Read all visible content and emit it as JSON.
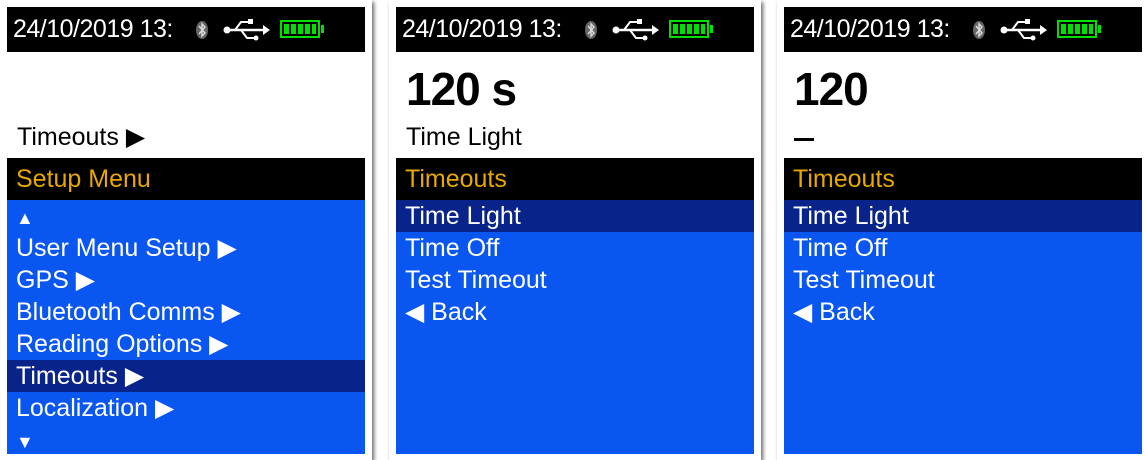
{
  "screens": [
    {
      "status": {
        "datetime": "24/10/2019  13:"
      },
      "display": {
        "value": "",
        "label": "Timeouts ▶"
      },
      "menu": {
        "title": "Setup Menu",
        "scroll_up": "▲",
        "items": [
          "User Menu Setup ▶",
          "GPS ▶",
          "Bluetooth Comms ▶",
          "Reading Options ▶",
          "Timeouts ▶",
          "Localization ▶"
        ],
        "selected_index": 4,
        "scroll_down": "▼"
      }
    },
    {
      "status": {
        "datetime": "24/10/2019  13:"
      },
      "display": {
        "value": "120 s",
        "label": "Time Light"
      },
      "menu": {
        "title": "Timeouts",
        "items": [
          "Time Light",
          "Time Off",
          "Test Timeout"
        ],
        "selected_index": 0,
        "back": "◀  Back"
      }
    },
    {
      "status": {
        "datetime": "24/10/2019  13:"
      },
      "display": {
        "value": "120",
        "label": ""
      },
      "menu": {
        "title": "Timeouts",
        "items": [
          "Time Light",
          "Time Off",
          "Test Timeout"
        ],
        "selected_index": 0,
        "back": "◀  Back"
      }
    }
  ],
  "colors": {
    "menu_bg": "#0a56f0",
    "selected_bg": "#08238a",
    "title_text": "#e8a700",
    "battery": "#00e000"
  },
  "icons": [
    "bluetooth-icon",
    "usb-icon",
    "battery-icon",
    "arrow-right-icon",
    "arrow-left-icon",
    "scroll-up-icon",
    "scroll-down-icon"
  ]
}
